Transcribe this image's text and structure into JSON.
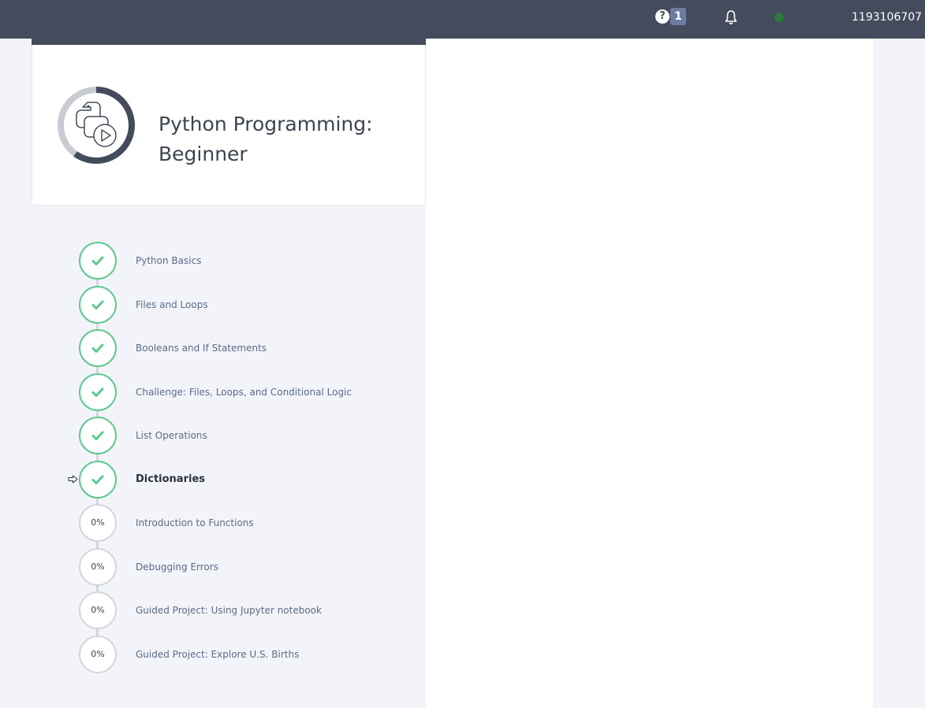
{
  "topbar": {
    "help_icon": "question-circle-icon",
    "help_badge": "1",
    "notification_icon": "bell-icon",
    "status_color": "#2f7a3c",
    "username": "1193106707"
  },
  "course": {
    "title": "Python Programming: Beginner",
    "icon": "python-play-icon",
    "progress_ring": 0.6
  },
  "missions": [
    {
      "label": "Python Basics",
      "status": "complete"
    },
    {
      "label": "Files and Loops",
      "status": "complete"
    },
    {
      "label": "Booleans and If Statements",
      "status": "complete"
    },
    {
      "label": "Challenge: Files, Loops, and Conditional Logic",
      "status": "complete"
    },
    {
      "label": "List Operations",
      "status": "complete"
    },
    {
      "label": "Dictionaries",
      "status": "complete",
      "current": true
    },
    {
      "label": "Introduction to Functions",
      "status": "0%"
    },
    {
      "label": "Debugging Errors",
      "status": "0%"
    },
    {
      "label": "Guided Project: Using Jupyter notebook",
      "status": "0%"
    },
    {
      "label": "Guided Project: Explore U.S. Births",
      "status": "0%"
    }
  ],
  "colors": {
    "complete": "#5cc98d",
    "pending": "#d3d6dd",
    "topbar": "#444b5c"
  }
}
